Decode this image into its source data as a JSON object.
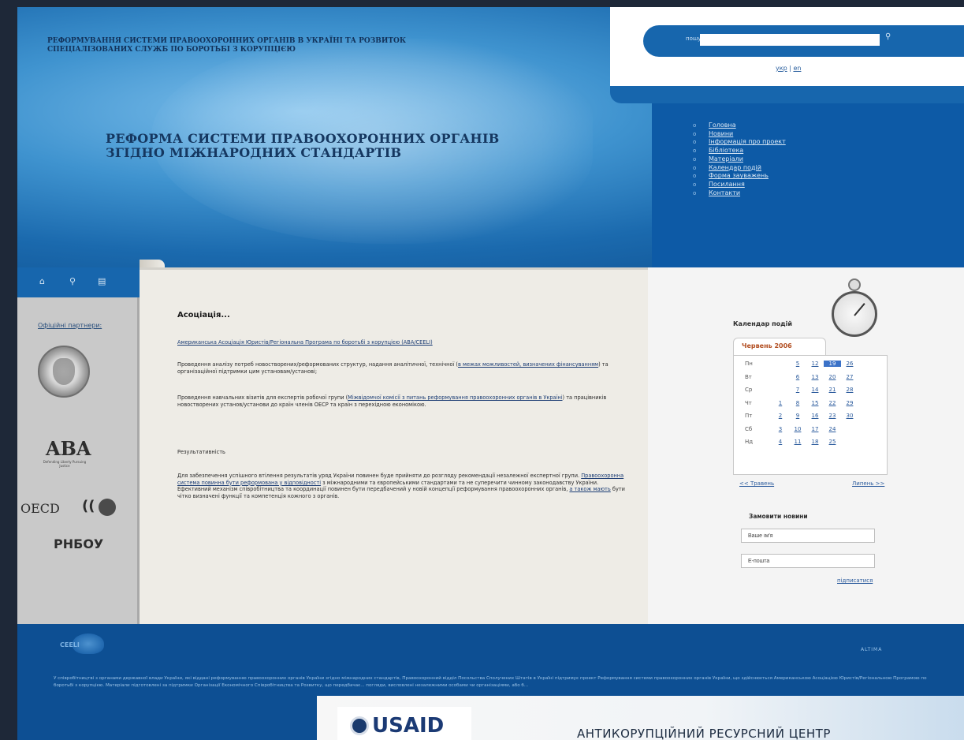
{
  "header": {
    "top_title": "РЕФОРМУВАННЯ СИСТЕМИ ПРАВООХОРОННИХ ОРГАНІВ В УКРАЇНІ ТА РОЗВИТОК СПЕЦІАЛІЗОВАНИХ СЛУЖБ ПО БОРОТЬБІ З КОРУПЦІЄЮ",
    "main_title": "РЕФОРМА СИСТЕМИ ПРАВООХОРОННИХ ОРГАНІВ ЗГІДНО МІЖНАРОДНИХ СТАНДАРТІВ"
  },
  "search": {
    "label": "пошук:",
    "placeholder": "",
    "button_icon": "search-icon"
  },
  "lang": {
    "ukr": "укр",
    "sep": " | ",
    "en": "en"
  },
  "nav": {
    "bullet": "o",
    "items": [
      {
        "label": "Головна"
      },
      {
        "label": "Новини"
      },
      {
        "label": "Інформація про проект"
      },
      {
        "label": "Бібліотека"
      },
      {
        "label": "Матеріали"
      },
      {
        "label": "Календар подій"
      },
      {
        "label": "Форма зауважень"
      },
      {
        "label": "Посилання"
      },
      {
        "label": "Контакти"
      }
    ]
  },
  "icons_bar": {
    "home": "⌂",
    "search": "⚲",
    "sitemap": "▤"
  },
  "sidebar": {
    "partners_title": "Офіційні партнери:",
    "aba_logo": "ABA",
    "aba_sub": "Defending Liberty Pursuing Justice",
    "oecd": "OECD",
    "oecd_mark": "((",
    "rnbou": "РНБОУ"
  },
  "content": {
    "title": "Асоціація...",
    "link_aba": "Американська Асоціація Юристів/Регіональна Програма по боротьбі з корупцією (ABA/CEELI)",
    "p1_text": "Проведення аналізу потреб новостворених/реформованих структур, надання аналітичної, технічної (",
    "p1_link": "в межах можливостей, визначених фінансуванням",
    "p1_tail": ") та організаційної підтримки цим установам/установі;",
    "p2_text": "Проведення навчальних візитів для експертів робочої групи (",
    "p2_link": "Міжвідомчої комісії з питань реформування правоохоронних органів в Україні",
    "p2_tail": ") та працівників новостворених установ/установи до країн членів ОЕСР та країн з перехідною економікою.",
    "results_title": "Результативність",
    "p3_text": "Для забезпечення успішного втілення результатів уряд України повинен буде прийняти до розгляду рекомендації незалежної експертної групи. ",
    "p3_link": "Правоохоронна система повинна бути реформована у відповідності",
    "p3_tail": " з міжнародними та європейськими стандартами та не суперечити чинному законодавству України.",
    "p4_text": "Ефективний механізм співробітництва та координації повинен бути передбачений у новій концепції реформування правоохоронних органів, ",
    "p4_link": "а також мають",
    "p4_tail": " бути чітко визначені функції та компетенція кожного з органів."
  },
  "calendar": {
    "title": "Календар подій",
    "month": "Червень 2006",
    "rows": [
      {
        "day": "Пн",
        "dates": [
          "",
          "5",
          "12",
          "19",
          "26"
        ]
      },
      {
        "day": "Вт",
        "dates": [
          "",
          "6",
          "13",
          "20",
          "27"
        ]
      },
      {
        "day": "Ср",
        "dates": [
          "",
          "7",
          "14",
          "21",
          "28"
        ]
      },
      {
        "day": "Чт",
        "dates": [
          "1",
          "8",
          "15",
          "22",
          "29"
        ]
      },
      {
        "day": "Пт",
        "dates": [
          "2",
          "9",
          "16",
          "23",
          "30"
        ]
      },
      {
        "day": "Сб",
        "dates": [
          "3",
          "10",
          "17",
          "24",
          ""
        ]
      },
      {
        "day": "Нд",
        "dates": [
          "4",
          "11",
          "18",
          "25",
          ""
        ]
      }
    ],
    "today": "19",
    "prev": "<< Травень",
    "next": "Липень >>"
  },
  "newsletter": {
    "title": "Замовити новини",
    "name_value": "Ваше ім'я",
    "email_value": "E-пошта",
    "subscribe": "підписатися"
  },
  "footer": {
    "ceeli": "CEELI",
    "altima": "ALTIMA",
    "text": "У співробітництві з органами державної влади України, які віддані реформуванню правоохоронних органів України згідно міжнародних стандартів, Правоохоронний відділ Посольства Сполучених Штатів в Україні підтримує проект Реформування системи правоохоронних органів України, що здійснюється Американською Асоціацією Юристів/Регіональною Програмою по боротьбі з корупцією. Матеріали підготовлені за підтримки Організації Економічного Співробітництва та Розвитку, що передбачає... погляди, висловлені незалежними особами чи організаціями, або б...",
    "usaid": "USAID",
    "arc_title": "АНТИКОРУПЦІЙНИЙ РЕСУРСНИЙ ЦЕНТР"
  }
}
